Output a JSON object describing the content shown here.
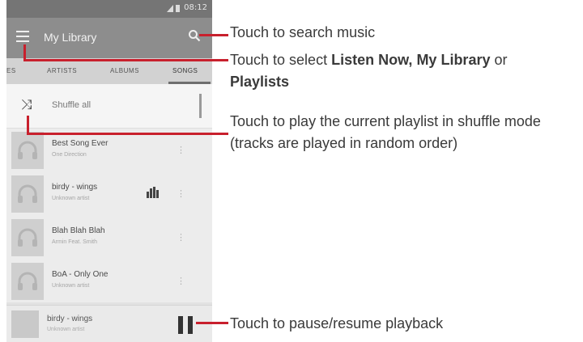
{
  "status_bar": {
    "time": "08:12"
  },
  "app_bar": {
    "title": "My Library"
  },
  "tabs": [
    "ES",
    "ARTISTS",
    "ALBUMS",
    "SONGS"
  ],
  "shuffle_row": {
    "label": "Shuffle all"
  },
  "songs": [
    {
      "title": "Best Song Ever",
      "artist": "One Direction",
      "playing": false
    },
    {
      "title": "birdy - wings",
      "artist": "Unknown artist",
      "playing": true
    },
    {
      "title": "Blah Blah Blah",
      "artist": "Armin Feat. Smith",
      "playing": false
    },
    {
      "title": "BoA - Only One",
      "artist": "Unknown artist",
      "playing": false
    }
  ],
  "now_playing": {
    "title": "birdy - wings",
    "artist": "Unknown artist"
  },
  "callouts": {
    "search": "Touch to search music",
    "menu_prefix": "Touch to select ",
    "menu_listen_now": "Listen Now,",
    "menu_my_library": "My Library",
    "menu_or": "or",
    "menu_playlists": "Playlists",
    "shuffle": "Touch to play the current playlist in shuffle mode (tracks are played in random order)",
    "pause": "Touch to pause/resume playback"
  },
  "colors": {
    "callout_red": "#c8202d",
    "app_bar": "#8d8d8d"
  }
}
